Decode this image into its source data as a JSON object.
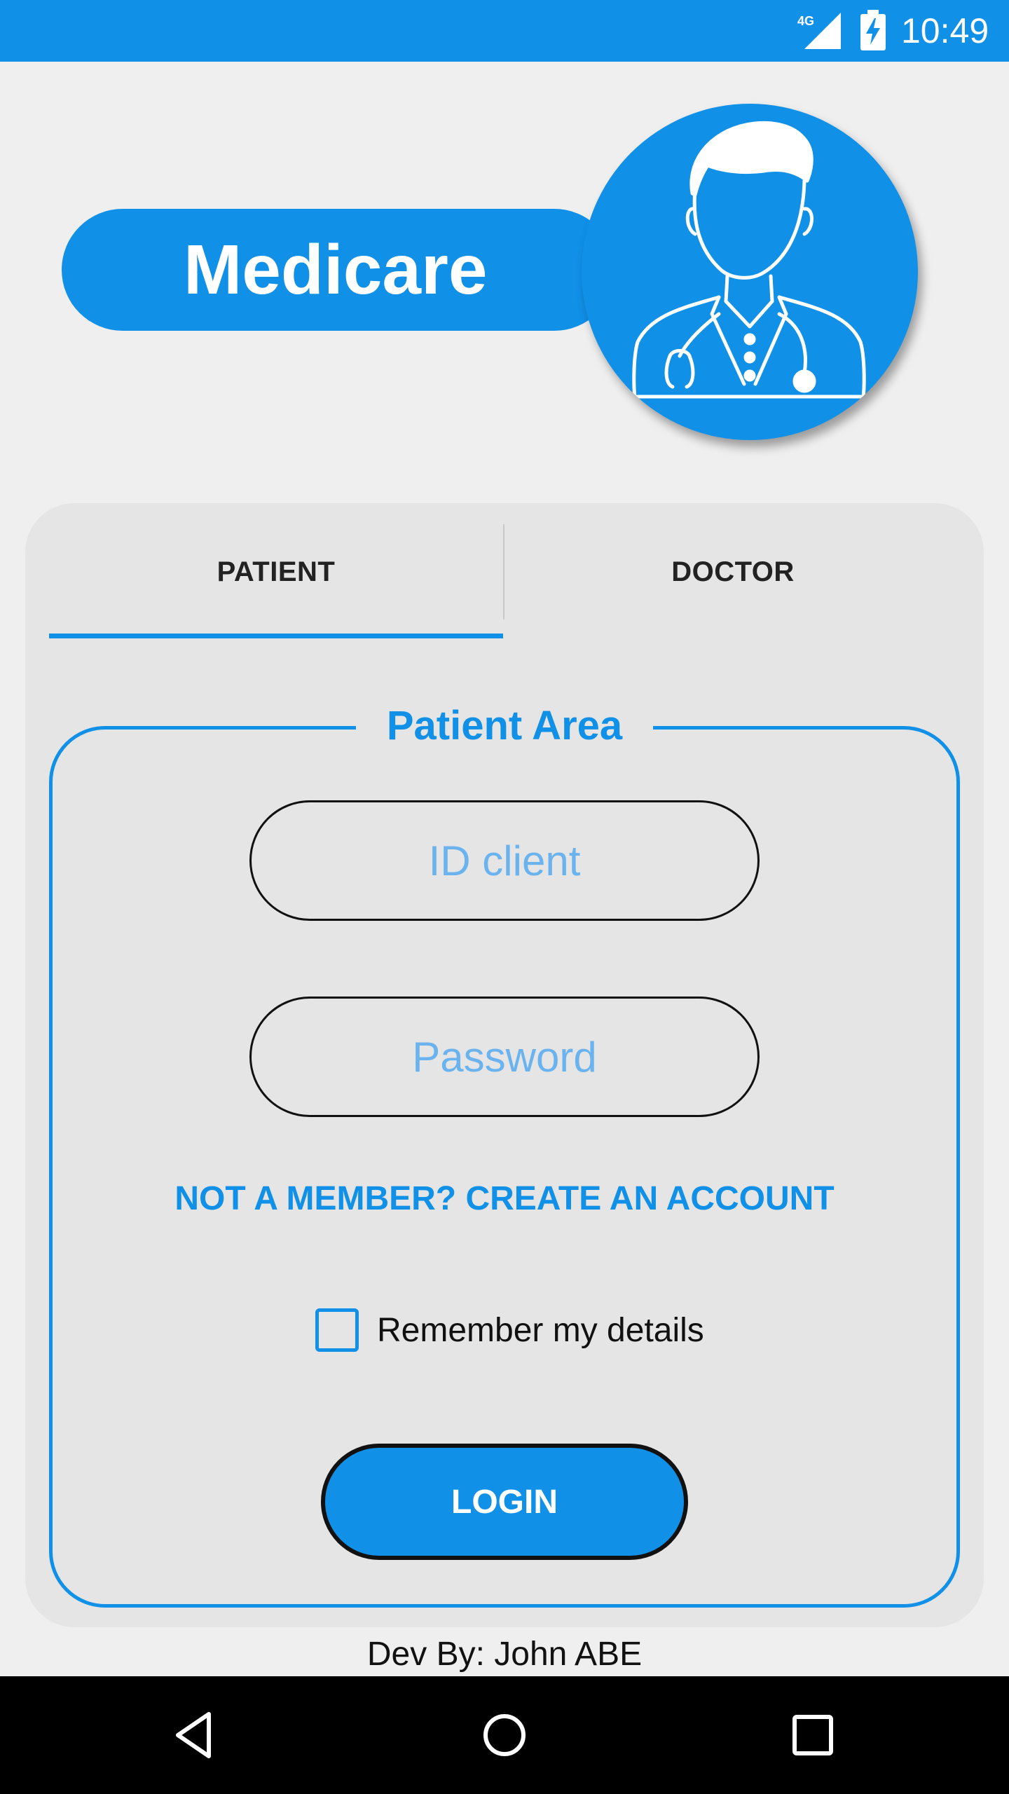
{
  "status_bar": {
    "network": "4G",
    "time": "10:49",
    "signal_icon": "signal-icon",
    "battery_icon": "battery-charging-icon"
  },
  "header": {
    "app_title": "Medicare",
    "avatar_icon": "doctor-icon"
  },
  "tabs": [
    {
      "label": "PATIENT",
      "selected": true
    },
    {
      "label": "DOCTOR",
      "selected": false
    }
  ],
  "patient_area": {
    "title": "Patient Area",
    "id_placeholder": "ID client",
    "password_placeholder": "Password",
    "create_account_link": "NOT A MEMBER? CREATE AN ACCOUNT",
    "remember_label": "Remember my details",
    "remember_checked": false,
    "login_label": "LOGIN"
  },
  "footer": {
    "credit": "Dev By: John ABE"
  },
  "nav_bar": {
    "back_icon": "back-icon",
    "home_icon": "home-icon",
    "recent_icon": "recent-apps-icon"
  },
  "colors": {
    "primary": "#1190e8",
    "background": "#efefef",
    "card": "#e5e5e5",
    "placeholder": "#6ab3ee"
  }
}
